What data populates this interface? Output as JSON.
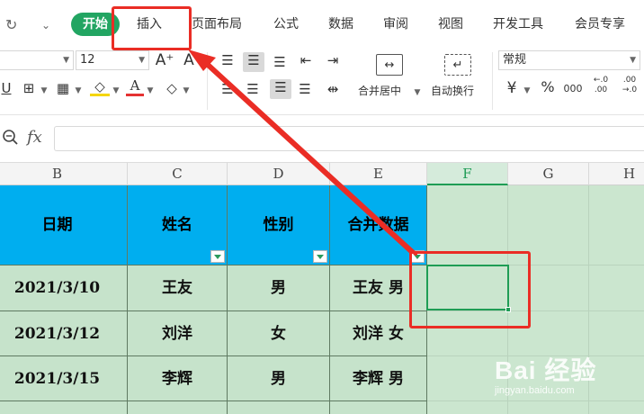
{
  "menu": {
    "active_tab": "开始",
    "tabs": [
      "插入",
      "页面布局",
      "公式",
      "数据",
      "审阅",
      "视图",
      "开发工具",
      "会员专享"
    ],
    "nav_icons": [
      "redo-icon",
      "customize-toolbar-icon"
    ]
  },
  "ribbon": {
    "font_size": "12",
    "font_grow": "A⁺",
    "number_format": "常规",
    "merge_label": "合并居中",
    "wrap_label": "自动换行",
    "currency_symbol": "¥",
    "percent_symbol": "%",
    "thousands_symbol": "000",
    "increase_decimal": "←.0 .00",
    "decrease_decimal": ".00 →.0"
  },
  "formula_bar": {
    "fx_label": "fx",
    "value": ""
  },
  "grid": {
    "columns": [
      "B",
      "C",
      "D",
      "E",
      "F",
      "G",
      "H"
    ],
    "selected_column": "F",
    "header_row": [
      "日期",
      "姓名",
      "性别",
      "合并数据"
    ],
    "rows": [
      [
        "2021/3/10",
        "王友",
        "男",
        "王友 男"
      ],
      [
        "2021/3/12",
        "刘洋",
        "女",
        "刘洋 女"
      ],
      [
        "2021/3/15",
        "李辉",
        "男",
        "李辉 男"
      ]
    ]
  },
  "watermark": {
    "brand": "Bai 经验",
    "url": "jingyan.baidu.com"
  },
  "colors": {
    "accent": "#22a562",
    "header_fill": "#00aeef",
    "row_fill": "#c6e3cb",
    "annotation": "#ea2d25"
  }
}
